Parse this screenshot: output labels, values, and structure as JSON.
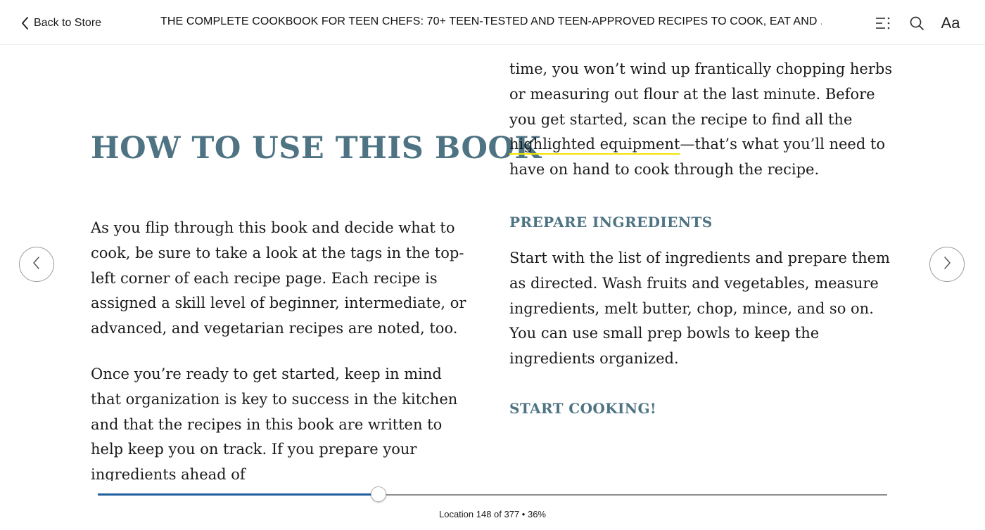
{
  "toolbar": {
    "back_label": "Back to Store",
    "book_title": "THE COMPLETE COOKBOOK FOR TEEN CHEFS: 70+ TEEN-TESTED AND TEEN-APPROVED RECIPES TO COOK, EAT AND ...",
    "font_label": "Aa",
    "icons": {
      "back": "chevron-left-icon",
      "toc": "table-of-contents-icon",
      "search": "search-icon",
      "font": "font-settings-icon"
    }
  },
  "content": {
    "chapter_title": "HOW TO USE THIS BOOK",
    "left_paragraphs": [
      "As you flip through this book and decide what to cook, be sure to take a look at the tags in the top-left corner of each recipe page. Each recipe is assigned a skill level of beginner, intermediate, or advanced, and vegetarian recipes are noted, too.",
      "Once you’re ready to get started, keep in mind that organization is key to success in the kitchen and that the recipes in this book are written to help keep you on track. If you prepare your ingredients ahead of"
    ],
    "right_continuation": {
      "before": "time, you won’t wind up frantically chopping herbs or measuring out flour at the last minute. Before you get started, scan the recipe to find all the ",
      "highlight": "highlighted equipment",
      "after": "—that’s what you’ll need to have on hand to cook through the recipe."
    },
    "section_prepare": "PREPARE INGREDIENTS",
    "prepare_paragraph": "Start with the list of ingredients and prepare them as directed. Wash fruits and vegetables, measure ingredients, melt butter, chop, mince, and so on. You can use small prep bowls to keep the ingredients organized.",
    "section_start": "START COOKING!"
  },
  "navigation": {
    "prev_icon": "chevron-left-icon",
    "next_icon": "chevron-right-icon"
  },
  "progress": {
    "location_text": "Location 148 of 377 • 36%",
    "fraction": 0.356,
    "fill_color": "#1f5f9e"
  },
  "colors": {
    "heading": "#4e7383",
    "highlight_underline": "#f2e600"
  }
}
